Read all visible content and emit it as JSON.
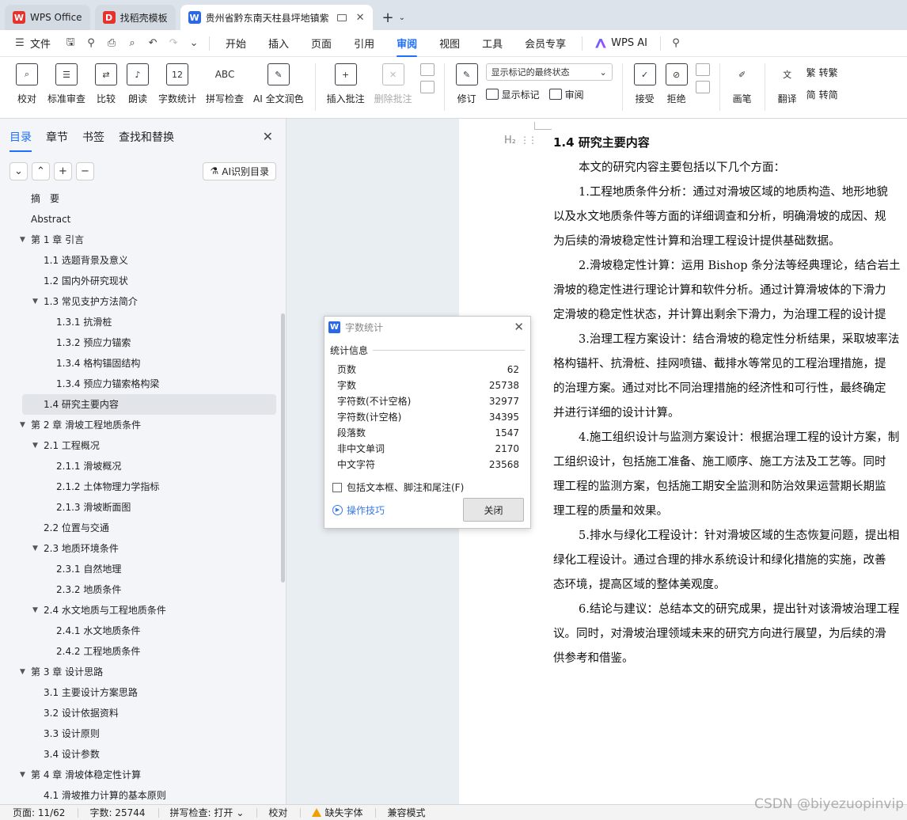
{
  "tabs": [
    {
      "label": "WPS Office",
      "logo": "W",
      "color": "#e5322d"
    },
    {
      "label": "找稻壳模板",
      "logo": "D",
      "color": "#e5322d"
    },
    {
      "label": "贵州省黔东南天柱县坪地镇紫",
      "logo": "W",
      "color": "#2b68e6"
    }
  ],
  "menu": {
    "file": "文件",
    "items": [
      "开始",
      "插入",
      "页面",
      "引用",
      "审阅",
      "视图",
      "工具",
      "会员专享"
    ],
    "active": "审阅",
    "wps_ai": "WPS AI"
  },
  "ribbon": {
    "proofread": "校对",
    "std_review": "标准审查",
    "compare": "比较",
    "read_aloud": "朗读",
    "word_count": "字数统计",
    "spell_check": "拼写检查",
    "ai_polish": "AI 全文润色",
    "insert_comment": "插入批注",
    "delete_comment": "删除批注",
    "revise": "修订",
    "markup_select": "显示标记的最终状态",
    "show_markup": "显示标记",
    "review": "审阅",
    "accept": "接受",
    "reject": "拒绝",
    "pen": "画笔",
    "translate": "翻译",
    "to_traditional": "转繁",
    "to_simplified": "转简"
  },
  "nav": {
    "tabs": [
      "目录",
      "章节",
      "书签",
      "查找和替换"
    ],
    "ai_toc": "AI识别目录",
    "toc": [
      {
        "text": "摘　要",
        "level": 0,
        "arrow": false
      },
      {
        "text": "Abstract",
        "level": 0,
        "arrow": false
      },
      {
        "text": "第 1 章  引言",
        "level": 0,
        "arrow": true
      },
      {
        "text": "1.1 选题背景及意义",
        "level": 1,
        "arrow": false
      },
      {
        "text": "1.2  国内外研究现状",
        "level": 1,
        "arrow": false
      },
      {
        "text": "1.3 常见支护方法简介",
        "level": 1,
        "arrow": true
      },
      {
        "text": "1.3.1  抗滑桩",
        "level": 2,
        "arrow": false
      },
      {
        "text": "1.3.2  预应力锚索",
        "level": 2,
        "arrow": false
      },
      {
        "text": "1.3.4  格构锚固结构",
        "level": 2,
        "arrow": false
      },
      {
        "text": "1.3.4  预应力锚索格构梁",
        "level": 2,
        "arrow": false
      },
      {
        "text": "1.4 研究主要内容",
        "level": 1,
        "arrow": false,
        "selected": true
      },
      {
        "text": "第 2 章  滑坡工程地质条件",
        "level": 0,
        "arrow": true
      },
      {
        "text": "2.1  工程概况",
        "level": 1,
        "arrow": true
      },
      {
        "text": "2.1.1  滑坡概况",
        "level": 2,
        "arrow": false
      },
      {
        "text": "2.1.2  土体物理力学指标",
        "level": 2,
        "arrow": false
      },
      {
        "text": "2.1.3  滑坡断面图",
        "level": 2,
        "arrow": false
      },
      {
        "text": "2.2  位置与交通",
        "level": 1,
        "arrow": false
      },
      {
        "text": "2.3 地质环境条件",
        "level": 1,
        "arrow": true
      },
      {
        "text": "2.3.1 自然地理",
        "level": 2,
        "arrow": false
      },
      {
        "text": "2.3.2 地质条件",
        "level": 2,
        "arrow": false
      },
      {
        "text": "2.4 水文地质与工程地质条件",
        "level": 1,
        "arrow": true
      },
      {
        "text": "2.4.1 水文地质条件",
        "level": 2,
        "arrow": false
      },
      {
        "text": "2.4.2 工程地质条件",
        "level": 2,
        "arrow": false
      },
      {
        "text": "第 3 章  设计思路",
        "level": 0,
        "arrow": true
      },
      {
        "text": "3.1  主要设计方案思路",
        "level": 1,
        "arrow": false
      },
      {
        "text": "3.2  设计依据资料",
        "level": 1,
        "arrow": false
      },
      {
        "text": "3.3 设计原则",
        "level": 1,
        "arrow": false
      },
      {
        "text": "3.4 设计参数",
        "level": 1,
        "arrow": false
      },
      {
        "text": "第 4 章  滑坡体稳定性计算",
        "level": 0,
        "arrow": true
      },
      {
        "text": "4.1  滑坡推力计算的基本原则",
        "level": 1,
        "arrow": false
      }
    ]
  },
  "doc": {
    "heading_mark": "H₂",
    "heading": "1.4 研究主要内容",
    "lines": [
      {
        "t": "本文的研究内容主要包括以下几个方面：",
        "ind": true
      },
      {
        "t": "1.工程地质条件分析：通过对滑坡区域的地质构造、地形地貌",
        "ind": true
      },
      {
        "t": "以及水文地质条件等方面的详细调查和分析，明确滑坡的成因、规",
        "ind": false
      },
      {
        "t": "为后续的滑坡稳定性计算和治理工程设计提供基础数据。",
        "ind": false
      },
      {
        "t": "2.滑坡稳定性计算：运用 Bishop 条分法等经典理论，结合岩土",
        "ind": true
      },
      {
        "t": "滑坡的稳定性进行理论计算和软件分析。通过计算滑坡体的下滑力",
        "ind": false
      },
      {
        "t": "定滑坡的稳定性状态，并计算出剩余下滑力，为治理工程的设计提",
        "ind": false
      },
      {
        "t": "3.治理工程方案设计：结合滑坡的稳定性分析结果，采取坡率法",
        "ind": true
      },
      {
        "t": "格构锚杆、抗滑桩、挂网喷锚、截排水等常见的工程治理措施，提",
        "ind": false
      },
      {
        "t": "的治理方案。通过对比不同治理措施的经济性和可行性，最终确定",
        "ind": false
      },
      {
        "t": "并进行详细的设计计算。",
        "ind": false
      },
      {
        "t": "4.施工组织设计与监测方案设计：根据治理工程的设计方案，制",
        "ind": true
      },
      {
        "t": "工组织设计，包括施工准备、施工顺序、施工方法及工艺等。同时",
        "ind": false
      },
      {
        "t": "理工程的监测方案，包括施工期安全监测和防治效果运营期长期监",
        "ind": false
      },
      {
        "t": "理工程的质量和效果。",
        "ind": false
      },
      {
        "t": "5.排水与绿化工程设计：针对滑坡区域的生态恢复问题，提出相",
        "ind": true
      },
      {
        "t": "绿化工程设计。通过合理的排水系统设计和绿化措施的实施，改善",
        "ind": false
      },
      {
        "t": "态环境，提高区域的整体美观度。",
        "ind": false
      },
      {
        "t": "6.结论与建议：总结本文的研究成果，提出针对该滑坡治理工程",
        "ind": true
      },
      {
        "t": "议。同时，对滑坡治理领域未来的研究方向进行展望，为后续的滑",
        "ind": false
      },
      {
        "t": "供参考和借鉴。",
        "ind": false
      }
    ]
  },
  "dialog": {
    "title": "字数统计",
    "group": "统计信息",
    "stats": [
      {
        "label": "页数",
        "value": "62"
      },
      {
        "label": "字数",
        "value": "25738"
      },
      {
        "label": "字符数(不计空格)",
        "value": "32977"
      },
      {
        "label": "字符数(计空格)",
        "value": "34395"
      },
      {
        "label": "段落数",
        "value": "1547"
      },
      {
        "label": "非中文单词",
        "value": "2170"
      },
      {
        "label": "中文字符",
        "value": "23568"
      }
    ],
    "checkbox": "包括文本框、脚注和尾注(F)",
    "tips": "操作技巧",
    "close": "关闭"
  },
  "status": {
    "page": "页面: 11/62",
    "words": "字数: 25744",
    "spell": "拼写检查: 打开",
    "proof": "校对",
    "missing_font": "缺失字体",
    "compat": "兼容模式"
  },
  "watermark": "CSDN @biyezuopinvip"
}
